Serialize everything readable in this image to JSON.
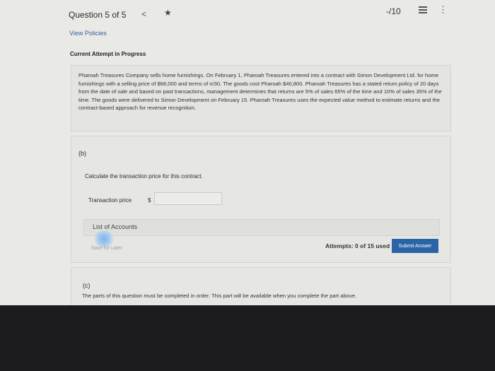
{
  "header": {
    "question": "Question 5 of 5",
    "back_glyph": "<",
    "star_glyph": "★",
    "score": "-/10",
    "more_glyph": "⋮"
  },
  "links": {
    "view_policies": "View Policies"
  },
  "attempt": {
    "title": "Current Attempt in Progress"
  },
  "problem": {
    "text": "Pharoah Treasures Company sells home furnishings. On February 1, Pharoah Treasures entered into a contract with Simon Development Ltd. for home furnishings with a selling price of $68,000 and terms of n/30. The goods cost Pharoah $40,800. Pharoah Treasures has a stated return policy of 20 days from the date of sale and based on past transactions, management determines that returns are 5% of sales 65% of the time and 10% of sales 35% of the time. The goods were delivered to Simon Development on February 15. Pharoah Treasures uses the expected value method to estimate returns and the contract-based approach for revenue recognition."
  },
  "part_b": {
    "label": "(b)",
    "instruction": "Calculate the transaction price for this contract.",
    "field_label": "Transaction price",
    "currency": "$",
    "field_value": "",
    "list_of_accounts": "List of Accounts",
    "save_for_later": "Save for Later",
    "attempts": "Attempts: 0 of 15 used",
    "submit": "Submit Answer"
  },
  "part_c": {
    "label": "(c)",
    "text": "The parts of this question must be completed in order. This part will be available when you complete the part above."
  },
  "colors": {
    "accent": "#2a64a8",
    "link": "#3a5f9e",
    "background": "#e9eae6"
  }
}
